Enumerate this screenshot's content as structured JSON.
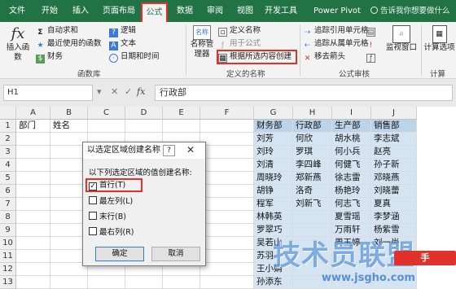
{
  "tabs": [
    "文件",
    "开始",
    "插入",
    "页面布局",
    "公式",
    "数据",
    "审阅",
    "视图",
    "开发工具",
    "Power Pivot"
  ],
  "tell_me": "告诉我你想要做什么",
  "ribbon": {
    "insert_function": "插入函数",
    "autosum": "自动求和",
    "recent": "最近使用的函数",
    "financial": "财务",
    "logical": "逻辑",
    "text": "文本",
    "datetime": "日期和时间",
    "library_label": "函数库",
    "name_manager": "名称管理器",
    "define_name": "定义名称",
    "use_in_formula": "用于公式",
    "create_from_selection": "根据所选内容创建",
    "defined_names_label": "定义的名称",
    "trace_precedents": "追踪引用单元格",
    "trace_dependents": "追踪从属单元格",
    "remove_arrows": "移去箭头",
    "audit_label": "公式审核",
    "watch_window": "监视窗口",
    "calc_options": "计算选项",
    "calc_label": "计算"
  },
  "formula_bar": {
    "name_box": "H1",
    "cancel": "✕",
    "enter": "✓",
    "fx": "fx",
    "content": "行政部"
  },
  "columns": [
    "A",
    "B",
    "C",
    "D",
    "E",
    "F",
    "G",
    "H",
    "I",
    "J"
  ],
  "rows": [
    "1",
    "2",
    "3",
    "4",
    "5",
    "6",
    "7",
    "8",
    "9",
    "10",
    "11",
    "12",
    "13"
  ],
  "a1": "部门",
  "b1": "姓名",
  "table": {
    "headers": [
      "财务部",
      "行政部",
      "生产部",
      "销售部"
    ],
    "g": [
      "刘芳",
      "刘玲",
      "刘清",
      "周晓玲",
      "胡铮",
      "程军",
      "林韩英",
      "罗翠巧",
      "吴若山",
      "苏羽",
      "王小娟",
      "孙添东"
    ],
    "h": [
      "何欣",
      "罗琪",
      "李四峰",
      "郑新燕",
      "洛奇",
      "刘新飞",
      "",
      "",
      "",
      "",
      "",
      ""
    ],
    "i": [
      "胡水桃",
      "何小兵",
      "何健飞",
      "徐志雷",
      "杨艳玲",
      "何志飞",
      "夏雪瑶",
      "万雨轩",
      "周玉婷",
      "",
      "",
      ""
    ],
    "j": [
      "李志斌",
      "赵亮",
      "孙子新",
      "邓晓燕",
      "刘晓蕾",
      "夏真",
      "李梦涵",
      "杨紫雪",
      "刘一尚",
      "",
      "",
      ""
    ]
  },
  "dialog": {
    "title": "以选定区域创建名称",
    "help": "?",
    "close": "✕",
    "prompt": "以下列选定区域的值创建名称:",
    "options": [
      {
        "label": "首行(T)",
        "checked": true
      },
      {
        "label": "最左列(L)",
        "checked": false
      },
      {
        "label": "末行(B)",
        "checked": false
      },
      {
        "label": "最右列(R)",
        "checked": false
      }
    ],
    "ok": "确定",
    "cancel": "取消"
  },
  "watermark": {
    "text": "技术员联盟",
    "badge": "手",
    "url": "www.jsgho.com"
  }
}
